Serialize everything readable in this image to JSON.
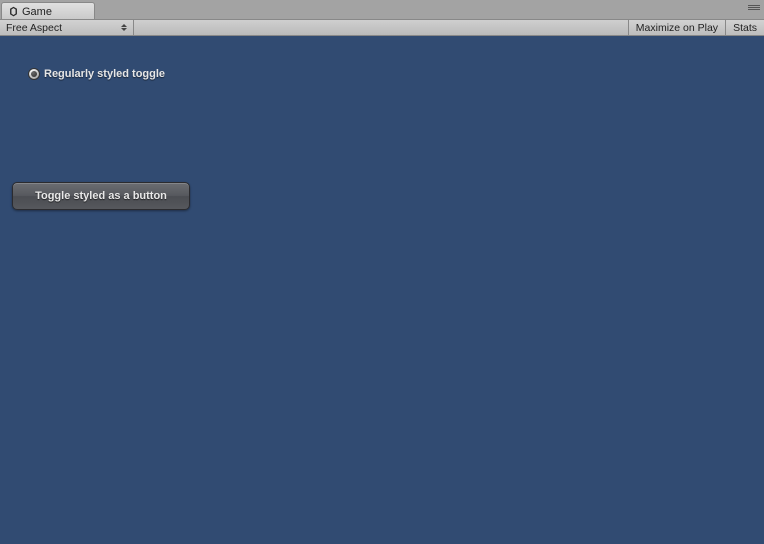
{
  "tab": {
    "label": "Game"
  },
  "toolbar": {
    "aspect_label": "Free Aspect",
    "maximize_label": "Maximize on Play",
    "stats_label": "Stats"
  },
  "content": {
    "radio_toggle_label": "Regularly styled toggle",
    "button_toggle_label": "Toggle styled as a button"
  },
  "colors": {
    "game_bg": "#314b72"
  }
}
